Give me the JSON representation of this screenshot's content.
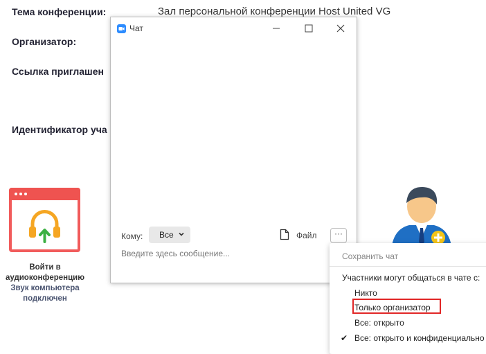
{
  "meeting": {
    "topic_label": "Тема конференции:",
    "topic_value": "Зал персональной конференции Host United VG",
    "host_label": "Организатор:",
    "invite_label": "Ссылка приглашен",
    "id_label": "Идентификатор уча"
  },
  "audio": {
    "line1": "Войти в",
    "line2": "аудиоконференцию",
    "status_line1": "Звук компьютера",
    "status_line2": "подключен",
    "icon": "headphones-upload-icon"
  },
  "chat": {
    "title": "Чат",
    "to_label": "Кому:",
    "to_value": "Все",
    "file_label": "Файл",
    "more_label": "···",
    "message_placeholder": "Введите здесь сообщение..."
  },
  "menu": {
    "save_chat": "Сохранить чат",
    "section_title": "Участники могут общаться в чате с:",
    "options": [
      {
        "label": "Никто",
        "checked": false
      },
      {
        "label": "Только организатор",
        "checked": false
      },
      {
        "label": "Все: открыто",
        "checked": false
      },
      {
        "label": "Все: открыто и конфиденциально",
        "checked": true
      }
    ],
    "check_mark": "✔"
  },
  "colors": {
    "accent": "#2d8cff",
    "audio_tile": "#ef5350",
    "highlight": "#e12626"
  }
}
